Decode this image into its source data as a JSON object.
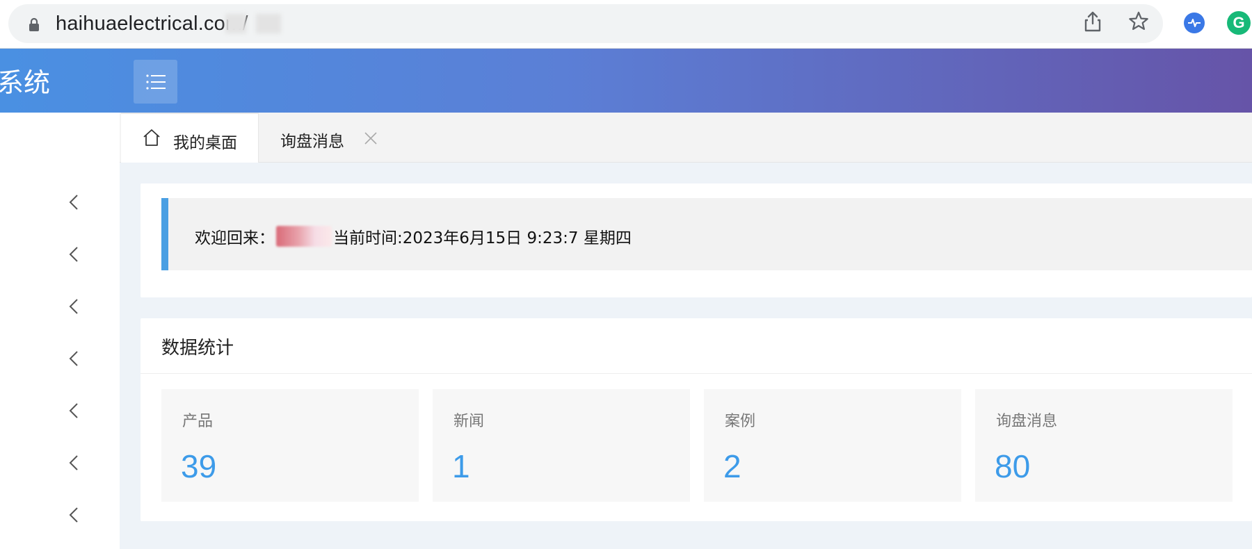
{
  "browser": {
    "url": "haihuaelectrical.com/",
    "icons": [
      "lock-icon",
      "share-icon",
      "star-icon",
      "ext-pulse-icon",
      "ext-g-icon"
    ],
    "ext_g_letter": "G"
  },
  "header": {
    "title": "系统",
    "menu_icon": "list-icon"
  },
  "sidebar": {
    "items": [
      {
        "icon": "chevron-left-icon"
      },
      {
        "icon": "chevron-left-icon"
      },
      {
        "icon": "chevron-left-icon"
      },
      {
        "icon": "chevron-left-icon"
      },
      {
        "icon": "chevron-left-icon"
      },
      {
        "icon": "chevron-left-icon"
      },
      {
        "icon": "chevron-left-icon"
      }
    ]
  },
  "tabs": [
    {
      "label": "我的桌面",
      "icon": "home-icon",
      "active": true
    },
    {
      "label": "询盘消息",
      "icon": "close-icon",
      "active": false
    }
  ],
  "welcome": {
    "prefix": "欢迎回来：",
    "time_text": "当前时间:2023年6月15日 9:23:7 星期四"
  },
  "stats": {
    "title": "数据统计",
    "items": [
      {
        "label": "产品",
        "value": "39"
      },
      {
        "label": "新闻",
        "value": "1"
      },
      {
        "label": "案例",
        "value": "2"
      },
      {
        "label": "询盘消息",
        "value": "80"
      }
    ]
  },
  "colors": {
    "accent": "#3d9be9",
    "header_start": "#4a90e2",
    "header_end": "#6654a8",
    "welcome_bar": "#4a9fe3"
  }
}
